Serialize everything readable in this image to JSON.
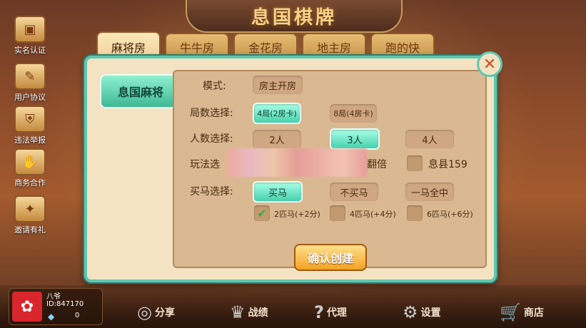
{
  "app": {
    "title": "息国棋牌"
  },
  "side_menu": [
    {
      "label": "实名认证",
      "icon": "id-card-icon"
    },
    {
      "label": "用户协议",
      "icon": "agreement-icon"
    },
    {
      "label": "违法举报",
      "icon": "report-shield-icon"
    },
    {
      "label": "商务合作",
      "icon": "handshake-icon"
    },
    {
      "label": "邀请有礼",
      "icon": "gift-icon"
    }
  ],
  "tabs": [
    "麻将房",
    "牛牛房",
    "金花房",
    "地主房",
    "跑的快"
  ],
  "mode_tag": "息国麻将",
  "form": {
    "mode": {
      "label": "模式:",
      "value": "房主开房"
    },
    "rounds": {
      "label": "局数选择:",
      "options": [
        "4局(2房卡)",
        "8局(4房卡)"
      ],
      "selected": 0
    },
    "players": {
      "label": "人数选择:",
      "options": [
        "2人",
        "3人",
        "4人"
      ],
      "selected": 1
    },
    "rules": {
      "label": "玩法选",
      "partial_option": "翻倍",
      "extra_option": "息县159"
    },
    "buy_horse": {
      "label": "买马选择:",
      "options": [
        "买马",
        "不买马",
        "一马全中"
      ],
      "selected": 0
    },
    "horse_counts": [
      {
        "label": "2匹马(+2分)",
        "checked": true
      },
      {
        "label": "4匹马(+4分)",
        "checked": false
      },
      {
        "label": "6匹马(+6分)",
        "checked": false
      }
    ],
    "confirm_label": "确认创建"
  },
  "user": {
    "name": "八爷",
    "id": "ID:847170",
    "diamonds": "0"
  },
  "bottom_nav": [
    {
      "label": "分享",
      "icon": "share-icon"
    },
    {
      "label": "战绩",
      "icon": "trophy-icon"
    },
    {
      "label": "代理",
      "icon": "question-icon"
    },
    {
      "label": "设置",
      "icon": "gear-icon"
    },
    {
      "label": "商店",
      "icon": "cart-icon"
    }
  ],
  "colors": {
    "accent": "#5ec7b0",
    "selected": "#46d1ad",
    "confirm": "#f2a324"
  }
}
